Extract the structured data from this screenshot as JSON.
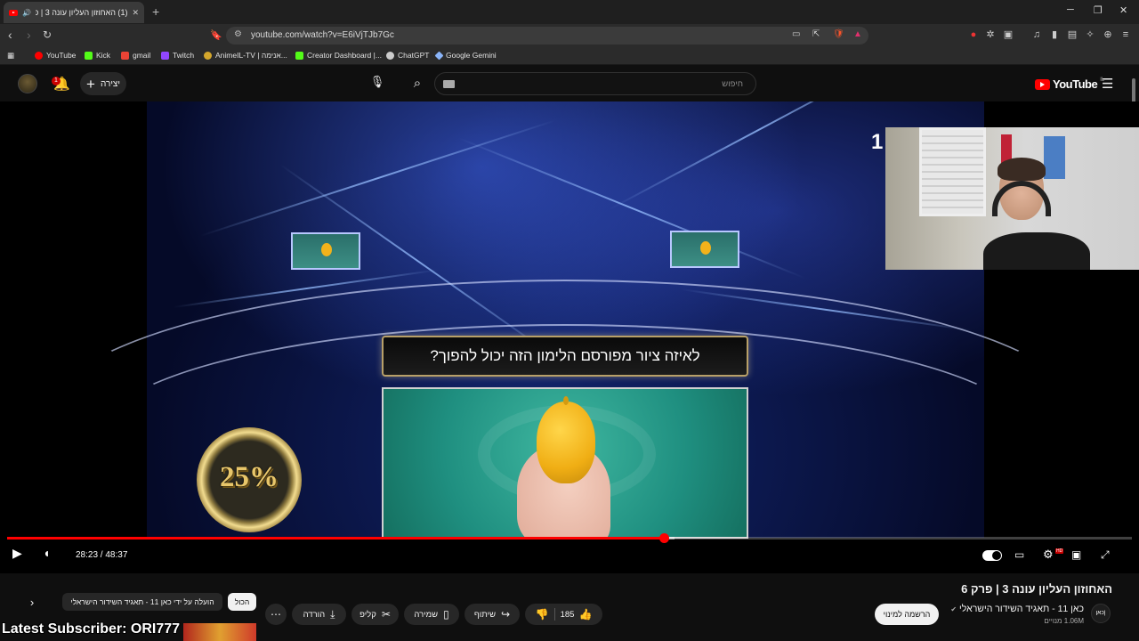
{
  "browser": {
    "tab_title": "(1) האחוזון העליון עונה 3 | פרק",
    "url": "youtube.com/watch?v=E6iVjTJb7Gc",
    "bookmarks": [
      {
        "label": "YouTube",
        "color": "#ff0000"
      },
      {
        "label": "Kick",
        "color": "#53fc18"
      },
      {
        "label": "gmail",
        "color": "#ea4335"
      },
      {
        "label": "Twitch",
        "color": "#9146ff"
      },
      {
        "label": "AnimeIL-TV | אנימה...",
        "color": "#d4a72c"
      },
      {
        "label": "Creator Dashboard |...",
        "color": "#53fc18"
      },
      {
        "label": "ChatGPT",
        "color": "#cccccc"
      },
      {
        "label": "Google Gemini",
        "color": "#8ab4f8"
      }
    ]
  },
  "masthead": {
    "notification_count": "1",
    "create_label": "יצירה",
    "search_placeholder": "חיפוש",
    "logo_text": "YouTube",
    "logo_country": "IL"
  },
  "video": {
    "question_text": "לאיזה ציור מפורסם הלימון הזה יכול להפוך?",
    "prize_label": "25%",
    "stage_number": "1",
    "current_time": "28:23",
    "duration": "48:37",
    "time_display": "28:23 / 48:37",
    "progress_fraction": 0.584,
    "buffer_fraction": 0.593,
    "quality_badge": "HD"
  },
  "details": {
    "title": "האחוזון העליון עונה 3 | פרק 6",
    "channel_avatar_text": "כאן|",
    "channel_name": "כאן 11 - תאגיד השידור הישראלי",
    "subscribers": "1.06M מנויים",
    "subscribe_label": "הרשמה למינוי",
    "like_count": "185",
    "share_label": "שיתוף",
    "save_label": "שמירה",
    "clip_label": "קליפ",
    "download_label": "הורדה",
    "chip_all": "הכול",
    "chip_uploaded": "הועלה על ידי כאן 11 - תאגיד השידור הישראלי"
  },
  "overlay": {
    "latest_subscriber": "Latest Subscriber: ORI777"
  },
  "colors": {
    "accent": "#ff0000",
    "background": "#0f0f0f",
    "pill": "#272727"
  }
}
